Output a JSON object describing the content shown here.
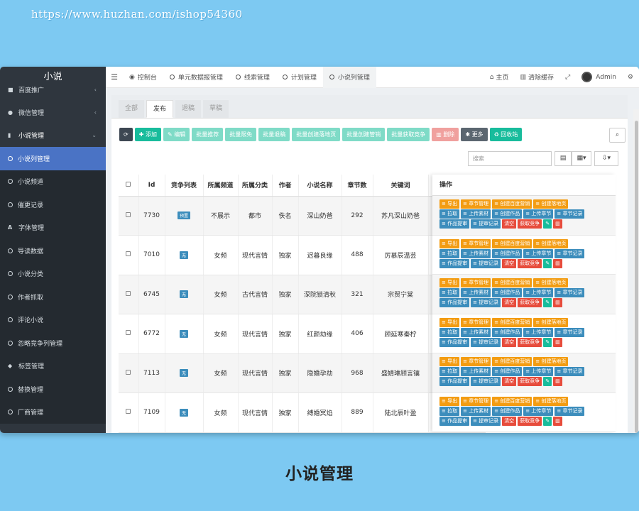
{
  "watermark": "https://www.huzhan.com/ishop54360",
  "caption": "小说管理",
  "sidebar": {
    "title": "小说",
    "items": [
      {
        "label": "百度推广",
        "icon": "grid-icon",
        "chev": "‹"
      },
      {
        "label": "微信管理",
        "icon": "wechat-icon",
        "chev": "‹"
      },
      {
        "label": "小说管理",
        "icon": "file-icon",
        "chev": "⌄"
      },
      {
        "label": "小说列管理",
        "icon": "circle-icon"
      },
      {
        "label": "小说频道",
        "icon": "circle-icon"
      },
      {
        "label": "催更记录",
        "icon": "circle-icon"
      },
      {
        "label": "字体管理",
        "icon": "font-icon"
      },
      {
        "label": "导读数据",
        "icon": "circle-icon"
      },
      {
        "label": "小说分类",
        "icon": "circle-icon"
      },
      {
        "label": "作者抓取",
        "icon": "circle-icon"
      },
      {
        "label": "评论小说",
        "icon": "circle-icon"
      },
      {
        "label": "忽略竞争列管理",
        "icon": "circle-icon"
      },
      {
        "label": "标签管理",
        "icon": "tag-icon"
      },
      {
        "label": "替换管理",
        "icon": "circle-icon"
      },
      {
        "label": "厂商管理",
        "icon": "circle-icon"
      }
    ]
  },
  "topbar": {
    "tabs": [
      "控制台",
      "单元数据报管理",
      "线索管理",
      "计划管理",
      "小说列管理"
    ],
    "home": "主页",
    "clear_cache": "清除缓存",
    "user": "Admin"
  },
  "content_tabs": [
    "全部",
    "发布",
    "退稿",
    "草稿"
  ],
  "toolbar": {
    "add": "添加",
    "edit": "编辑",
    "batch_recommend": "批量推荐",
    "batch_free": "批量限免",
    "batch_reject": "批量退稿",
    "batch_landing": "批量创建落地页",
    "batch_create_mgmt": "批量创建管销",
    "batch_fetch": "批量获取竞争",
    "delete": "删除",
    "more": "更多",
    "recycle": "回收站"
  },
  "search": {
    "placeholder": "搜索"
  },
  "table": {
    "headers": [
      "Id",
      "竞争列表",
      "所属频道",
      "所属分类",
      "作者",
      "小说名称",
      "章节数",
      "关键词"
    ],
    "ops_header": "操作",
    "rows": [
      {
        "id": "7730",
        "badge": "预置",
        "channel": "不展示",
        "category": "都市",
        "author": "佚名",
        "name": "深山奶爸",
        "chapters": "292",
        "keyword": "苏凡深山奶爸"
      },
      {
        "id": "7010",
        "badge": "无",
        "channel": "女频",
        "category": "现代言情",
        "author": "独家",
        "name": "迟暮良缘",
        "chapters": "488",
        "keyword": "厉慕辰温芸"
      },
      {
        "id": "6745",
        "badge": "无",
        "channel": "女频",
        "category": "古代言情",
        "author": "独家",
        "name": "深院锁清秋",
        "chapters": "321",
        "keyword": "宗贸宁棠"
      },
      {
        "id": "6772",
        "badge": "无",
        "channel": "女频",
        "category": "现代言情",
        "author": "独家",
        "name": "红颜劫缘",
        "chapters": "406",
        "keyword": "顾延寒秦柠"
      },
      {
        "id": "7113",
        "badge": "无",
        "channel": "女频",
        "category": "现代言情",
        "author": "独家",
        "name": "隐婚孕劫",
        "chapters": "968",
        "keyword": "盛婧琳顾言镶"
      },
      {
        "id": "7109",
        "badge": "无",
        "channel": "女频",
        "category": "现代言情",
        "author": "独家",
        "name": "缚婚冥焰",
        "chapters": "889",
        "keyword": "陆北辰叶盈"
      }
    ],
    "ops": {
      "export": "导出",
      "chapter_mgmt": "章节管理",
      "create_baidu": "创建百度营销",
      "create_landing": "创建落地页",
      "pull": "拉取",
      "upload_material": "上传素材",
      "create_work": "创建作品",
      "upload_chapter": "上传章节",
      "chapter_record": "章节记录",
      "work_submit": "作品提审",
      "submit_record": "提审记录",
      "clear": "清空",
      "get_competition": "获取竞争"
    }
  }
}
